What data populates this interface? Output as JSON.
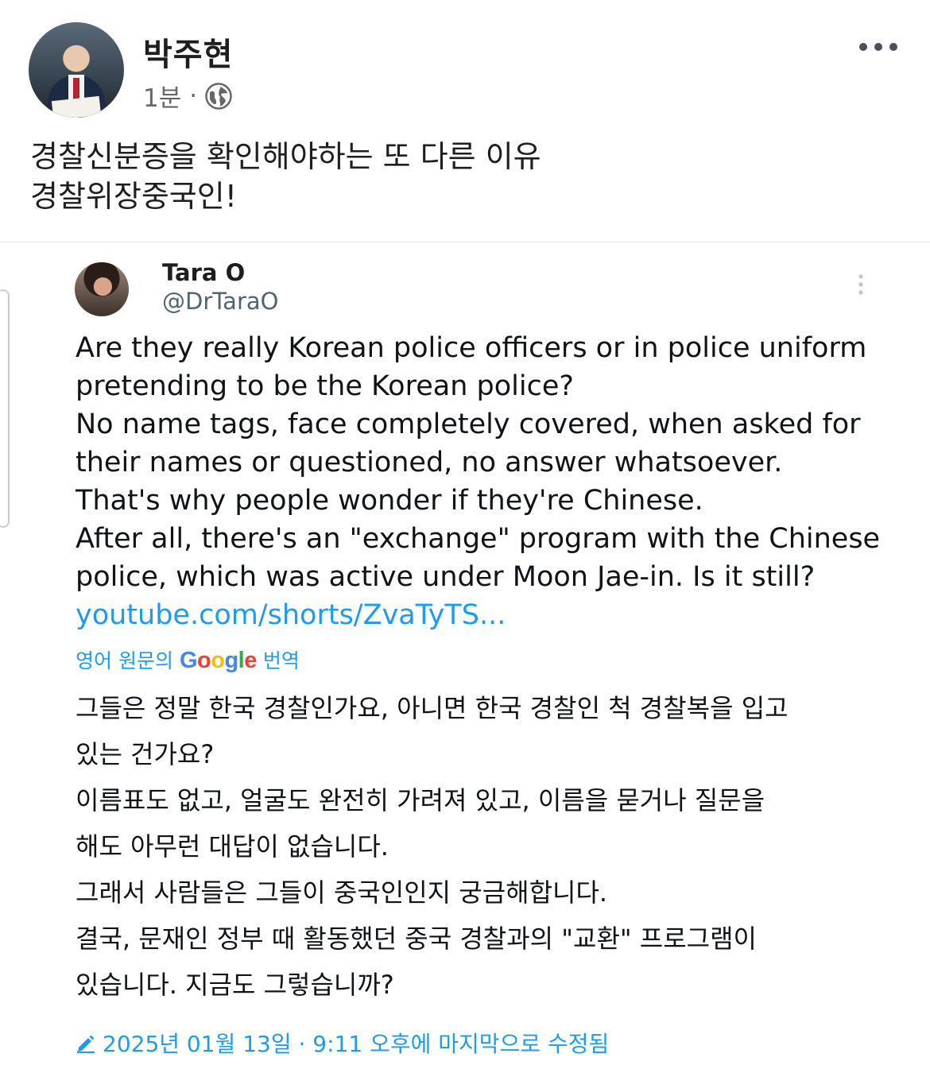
{
  "post": {
    "author": "박주현",
    "time": "1분",
    "separator": "·",
    "privacy_icon": "globe-icon",
    "more_icon": "more-horizontal-icon",
    "text_lines": [
      "경찰신분증을 확인해야하는 또 다른 이유",
      "경찰위장중국인!"
    ]
  },
  "embedded_tweet": {
    "name": "Tara O",
    "handle": "@DrTaraO",
    "text_lines": [
      "Are they really Korean police officers or in police uniform",
      "pretending to be the Korean police?",
      "No name tags, face completely covered, when asked for",
      "their names or questioned, no answer whatsoever.",
      "That's why people wonder if they're Chinese.",
      "After all, there's an \"exchange\" program with the Chinese",
      "police, which was active under Moon Jae-in. Is it still?"
    ],
    "link": "youtube.com/shorts/ZvaTyTS...",
    "translation": {
      "prefix": "영어 원문의",
      "google": "Google",
      "suffix": "번역",
      "lines": [
        "그들은 정말 한국 경찰인가요, 아니면 한국 경찰인 척 경찰복을 입고",
        "있는 건가요?",
        "이름표도 없고, 얼굴도 완전히 가려져 있고, 이름을 묻거나 질문을",
        "해도 아무런 대답이 없습니다.",
        "그래서 사람들은 그들이 중국인인지 궁금해합니다.",
        "결국, 문재인 정부 때 활동했던 중국 경찰과의 \"교환\" 프로그램이",
        "있습니다. 지금도 그렇습니까?"
      ]
    },
    "edited_text": "2025년 01월 13일 · 9:11 오후에 마지막으로 수정됨"
  },
  "colors": {
    "link_blue": "#1d9bf0",
    "meta_gray": "#65676b",
    "google": [
      "#4285F4",
      "#EA4335",
      "#FBBC05",
      "#4285F4",
      "#34A853",
      "#EA4335"
    ]
  }
}
